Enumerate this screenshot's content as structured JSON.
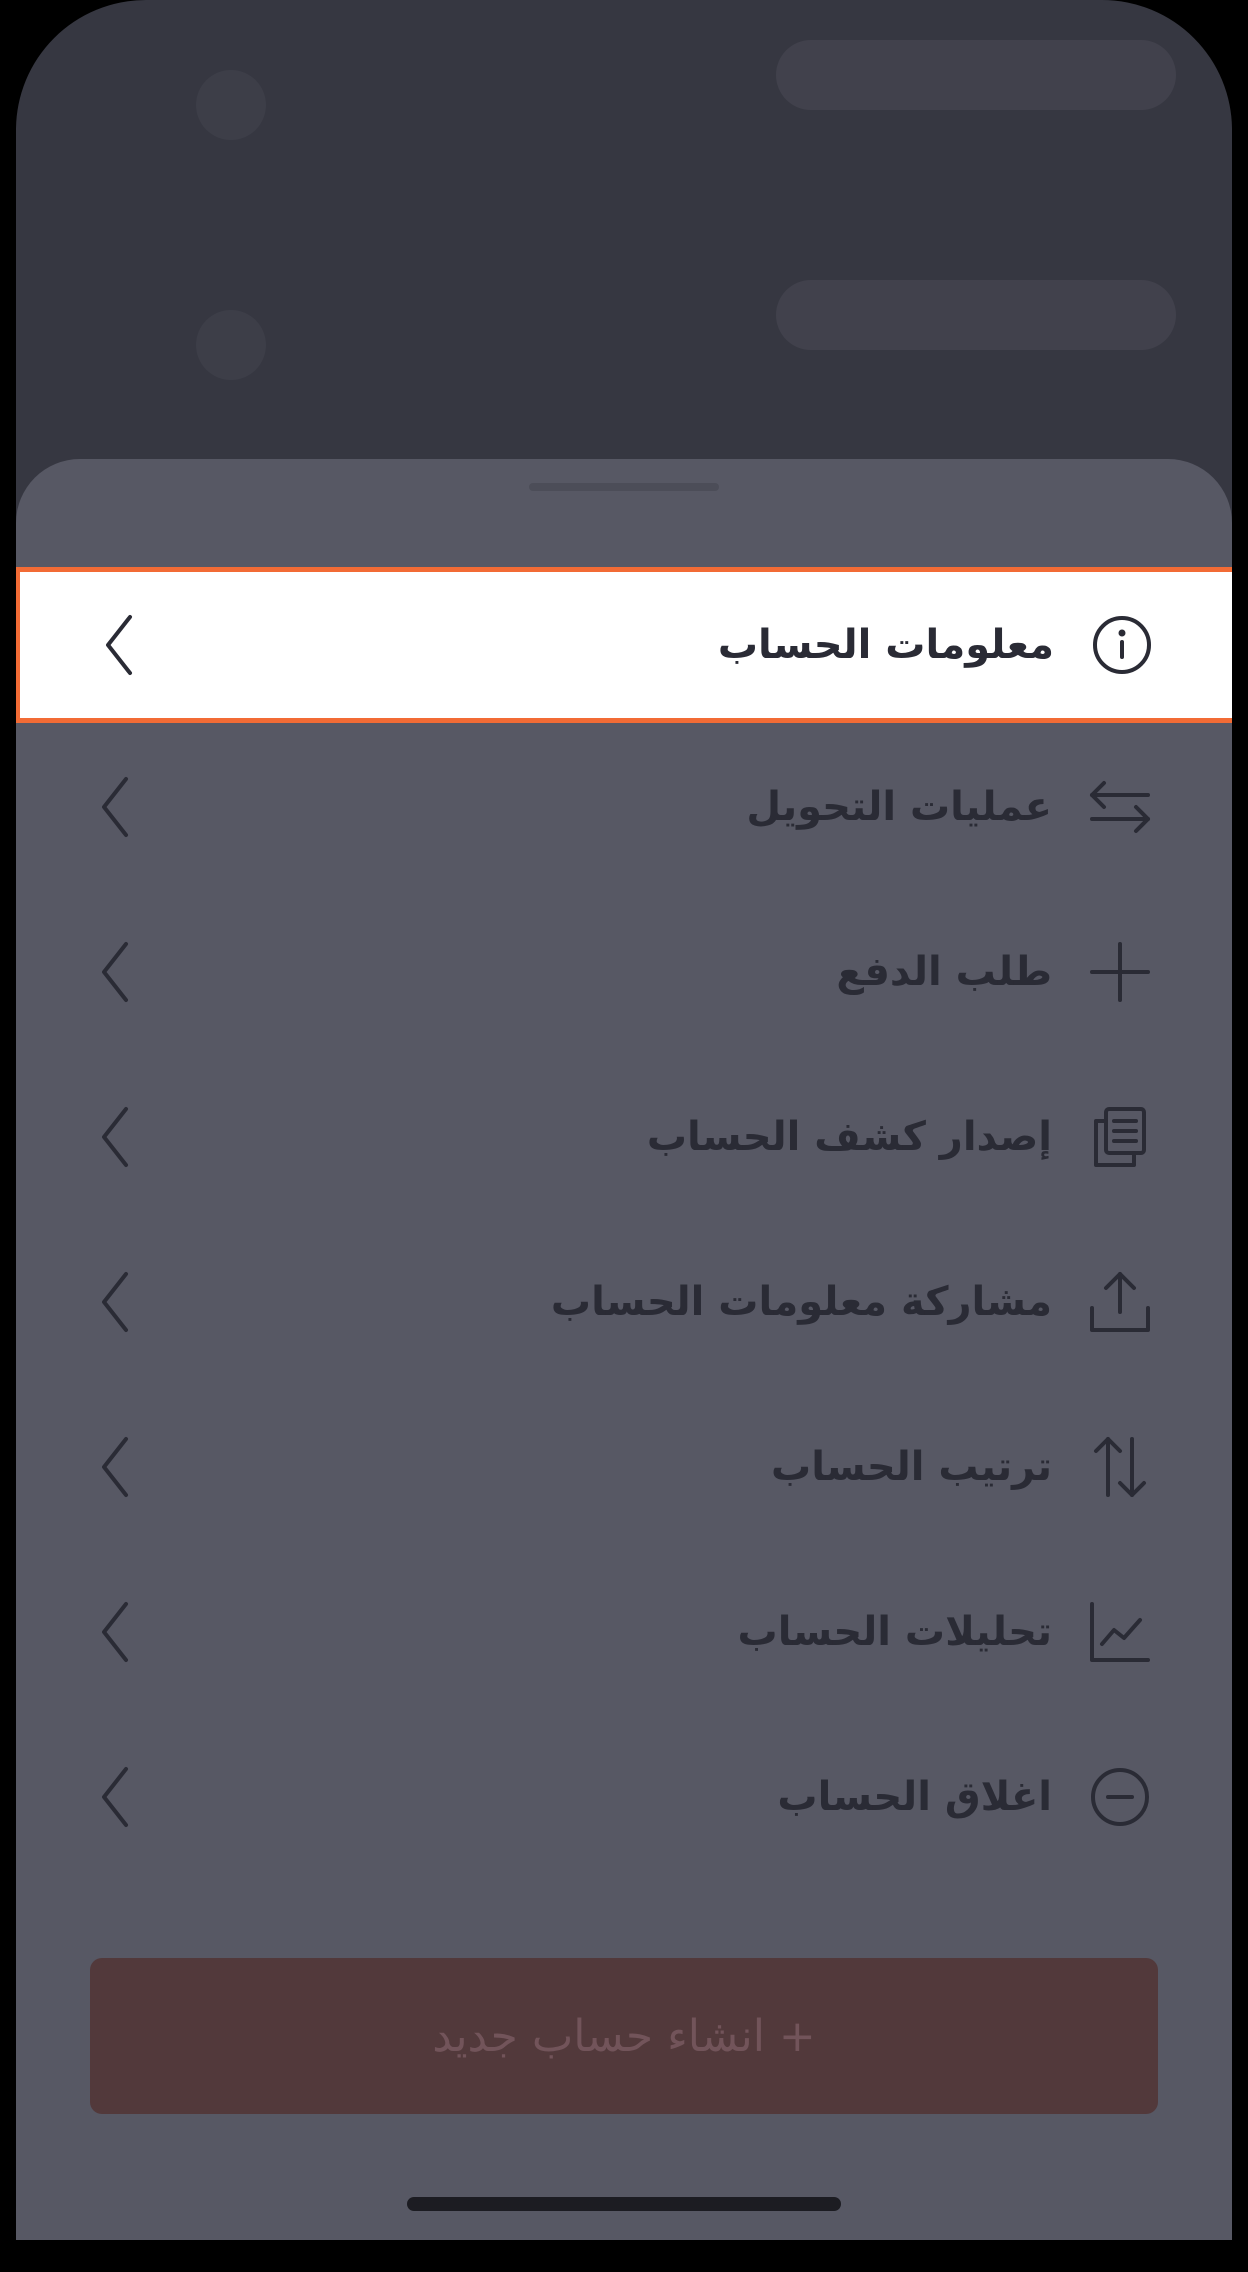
{
  "colors": {
    "accent_highlight_border": "#f26b35",
    "sheet_background": "#575864",
    "backdrop": "#363741",
    "button_background": "#52393b",
    "text_dark": "#2a2b35"
  },
  "menu": {
    "items": [
      {
        "label": "معلومات الحساب",
        "icon": "info-icon",
        "highlighted": true
      },
      {
        "label": "عمليات التحويل",
        "icon": "transfer-arrows-icon"
      },
      {
        "label": "طلب الدفع",
        "icon": "plus-icon"
      },
      {
        "label": "إصدار كشف الحساب",
        "icon": "document-copy-icon"
      },
      {
        "label": "مشاركة معلومات الحساب",
        "icon": "share-upload-icon"
      },
      {
        "label": "ترتيب الحساب",
        "icon": "sort-arrows-icon"
      },
      {
        "label": "تحليلات الحساب",
        "icon": "chart-line-icon"
      },
      {
        "label": "اغلاق الحساب",
        "icon": "minus-circle-icon"
      }
    ]
  },
  "actions": {
    "new_account_label": "+ انشاء حساب جديد"
  }
}
